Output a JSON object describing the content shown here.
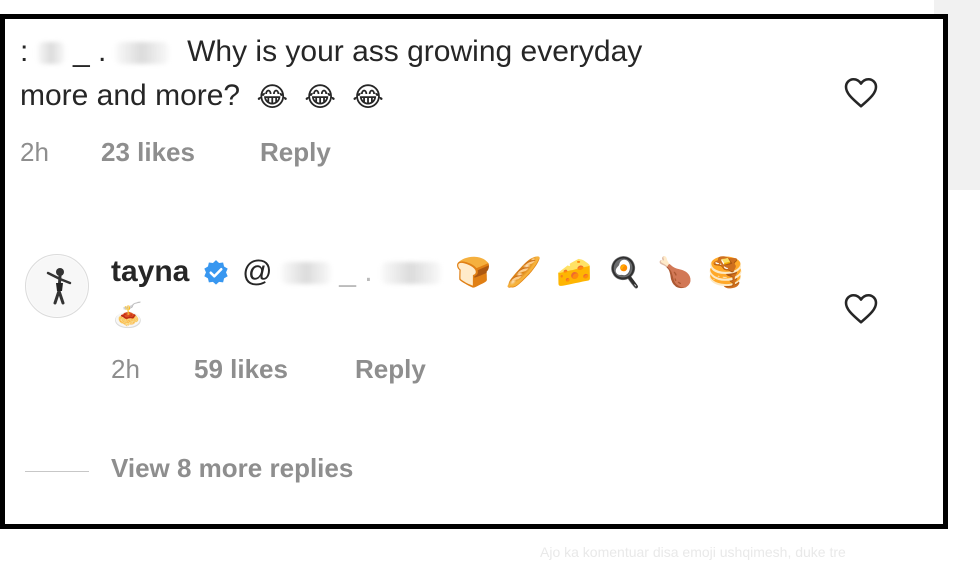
{
  "comment1": {
    "username_prefix": ":",
    "username_partial": "_ .",
    "text_line1": "Why is your ass growing everyday",
    "text_line2": "more and more?",
    "emojis": [
      "😂",
      "😂",
      "😂"
    ],
    "time": "2h",
    "likes": "23 likes",
    "reply_label": "Reply",
    "icon": "heart-outline-icon"
  },
  "comment2": {
    "username": "tayna",
    "verified_icon": "verified-badge-icon",
    "mention_at": "@",
    "mention_partial": "_ .",
    "emojis_line1": [
      "🍞",
      "🥖",
      "🧀",
      "🍳",
      "🍗",
      "🥞"
    ],
    "emojis_line2": [
      "🍝"
    ],
    "time": "2h",
    "likes": "59 likes",
    "reply_label": "Reply",
    "icon": "heart-outline-icon"
  },
  "view_replies": "View 8 more replies",
  "background_caption": "Ajo ka komentuar disa emoji ushqimesh, duke tre",
  "colors": {
    "text": "#262626",
    "meta": "#8e8e8e",
    "verified": "#3897f0",
    "frame": "#000000"
  }
}
